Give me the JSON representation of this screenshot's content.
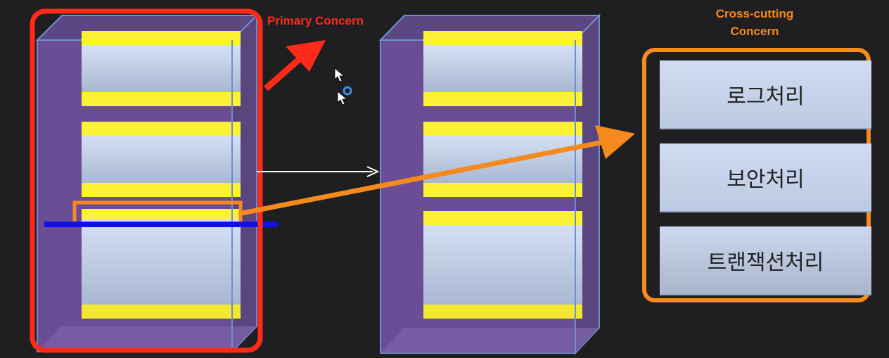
{
  "labels": {
    "primary": "Primary Concern",
    "cross_line1": "Cross-cutting",
    "cross_line2": "Concern"
  },
  "concerns": [
    {
      "label": "로그처리"
    },
    {
      "label": "보안처리"
    },
    {
      "label": "트랜잭션처리"
    }
  ],
  "colors": {
    "background": "#1f1f21",
    "primary_accent": "#ff2a17",
    "cross_accent": "#f58a1f",
    "module_body": "#6b4d96",
    "module_edge": "#5b7fbf",
    "band": "#fbf235",
    "panel": "#c5d4ee",
    "join_point": "#1010ee"
  }
}
